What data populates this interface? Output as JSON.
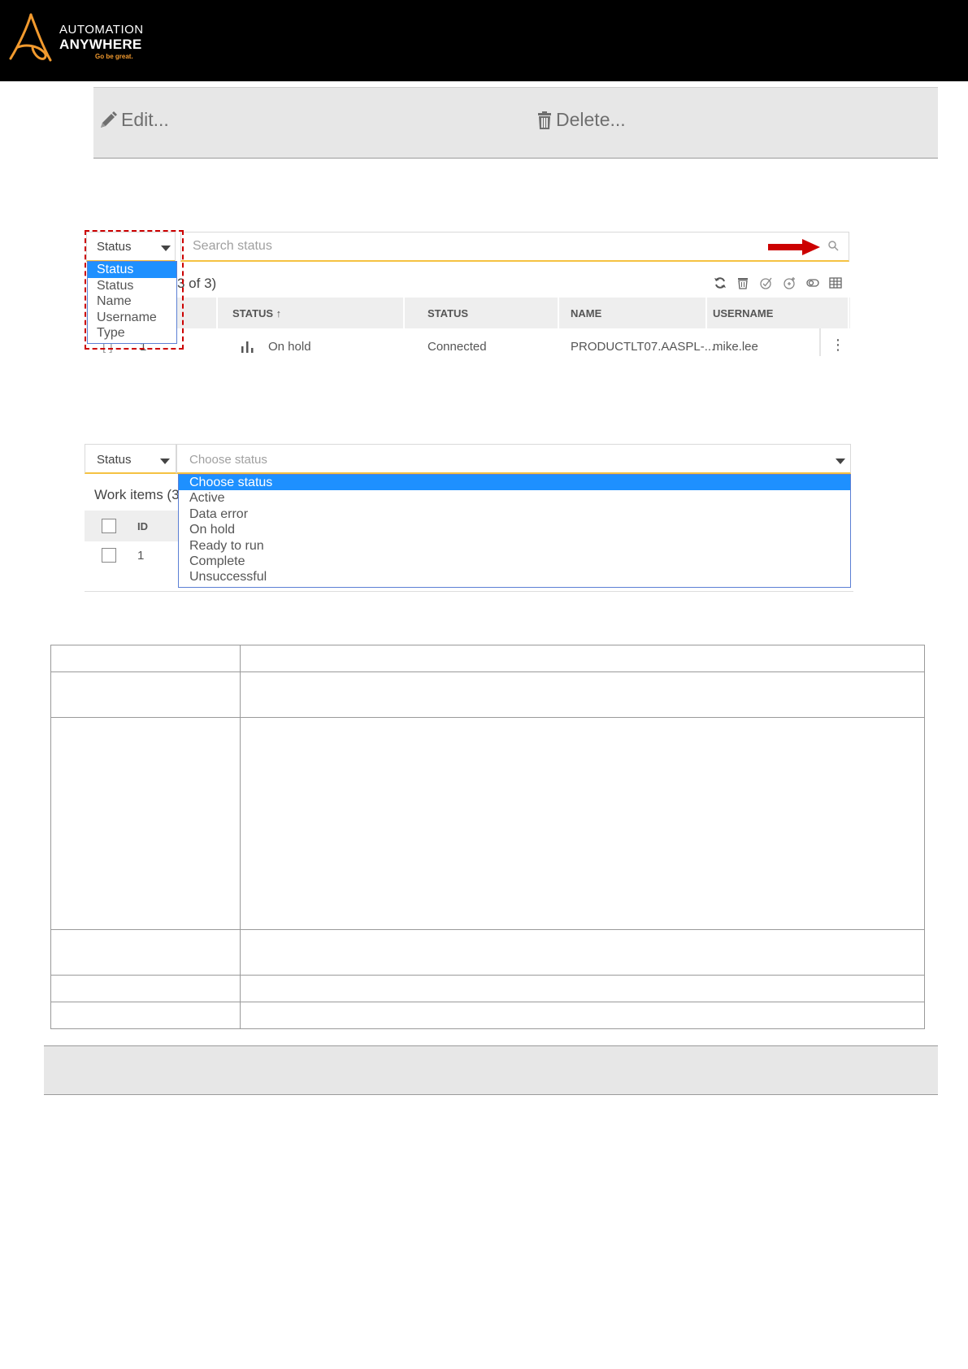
{
  "header": {
    "logo_line1": "AUTOMATION",
    "logo_line2": "ANYWHERE",
    "logo_tagline": "Go be great.",
    "brand_color": "#f29a2e",
    "background_color": "#000000"
  },
  "actions": {
    "edit_label": "Edit...",
    "delete_label": "Delete...",
    "edit_icon": "pencil-icon",
    "delete_icon": "trash-icon"
  },
  "screenshot1": {
    "filter_selected": "Status",
    "search_placeholder": "Search status",
    "count_text": "3 of 3)",
    "columns": [
      "STATUS ↑",
      "STATUS",
      "NAME",
      "USERNAME"
    ],
    "row": {
      "checkbox": "[ ]",
      "id": "1",
      "status_icon": "bar-chart-icon",
      "work_status": "On hold",
      "device_status": "Connected",
      "name": "PRODUCTLT07.AASPL-...",
      "username": "mike.lee",
      "menu": "⋮"
    },
    "dropdown_options": [
      "Status",
      "Status",
      "Name",
      "Username",
      "Type"
    ],
    "dropdown_selected_index": 0,
    "toolbar_icons": [
      "refresh-icon",
      "trash-icon",
      "check-circle-icon",
      "add-circle-icon",
      "toggle-icon",
      "grid-icon"
    ],
    "highlight_color": "#cc0000",
    "arrow_color": "#cc0000"
  },
  "screenshot2": {
    "filter_selected": "Status",
    "status_placeholder": "Choose status",
    "work_items_text": "Work items (3",
    "id_header": "ID",
    "row_id": "1",
    "dropdown_options": [
      "Choose status",
      "Active",
      "Data error",
      "On hold",
      "Ready to run",
      "Complete",
      "Unsuccessful"
    ],
    "dropdown_selected_index": 0
  },
  "accent": {
    "select_underline": "#f5c242",
    "selection_blue": "#1e90ff"
  }
}
